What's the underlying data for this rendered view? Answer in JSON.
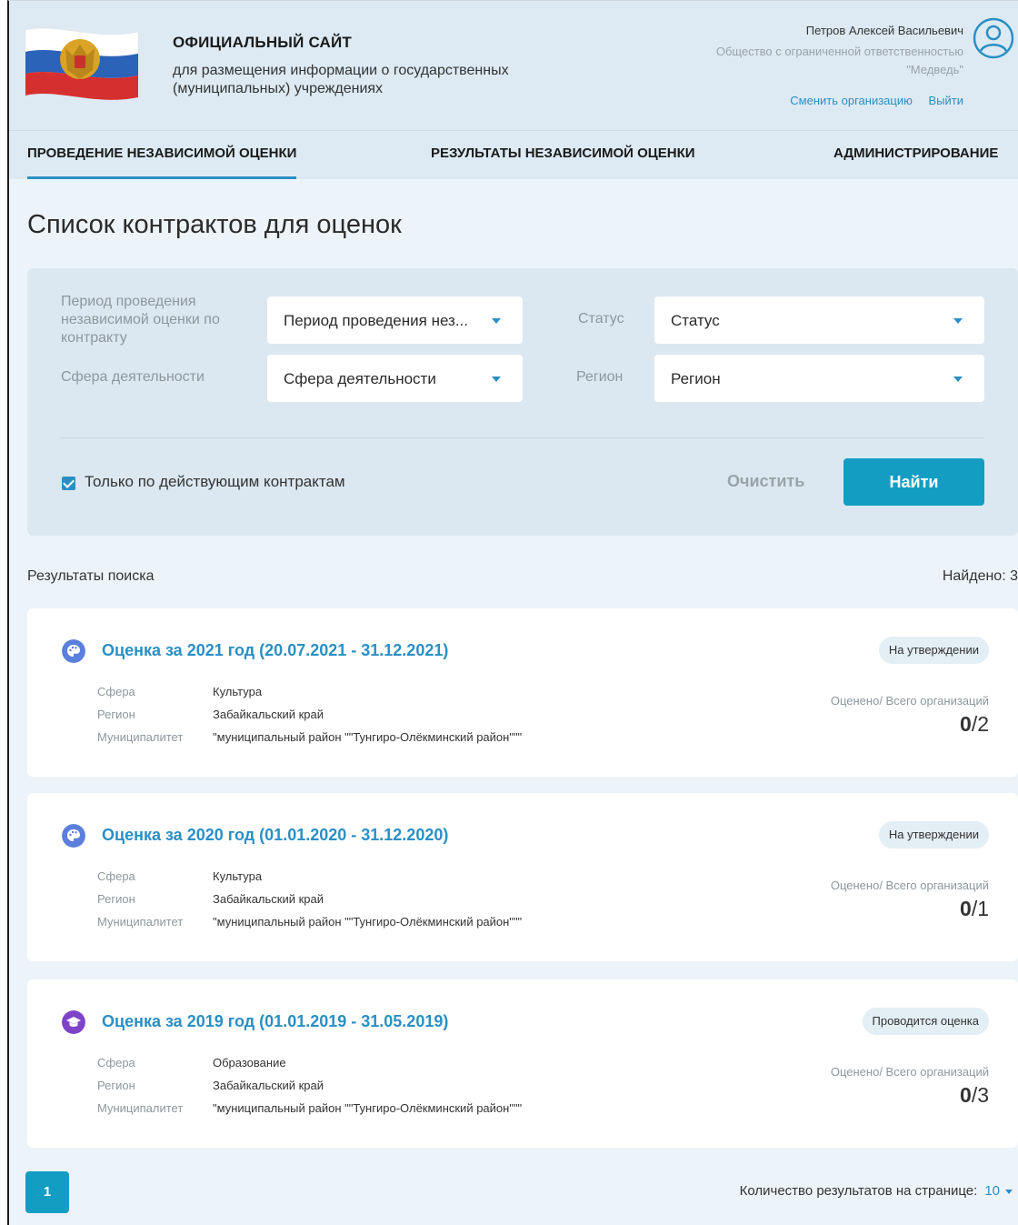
{
  "header": {
    "title": "ОФИЦИАЛЬНЫЙ САЙТ",
    "subtitle": "для размещения информации о государственных (муниципальных) учреждениях",
    "user_name": "Петров Алексей Васильевич",
    "user_org": "Общество с ограниченной ответственностью \"Медведь\"",
    "change_org": "Сменить организацию",
    "logout": "Выйти"
  },
  "nav": {
    "items": [
      {
        "label": "ПРОВЕДЕНИЕ НЕЗАВИСИМОЙ ОЦЕНКИ",
        "active": true
      },
      {
        "label": "РЕЗУЛЬТАТЫ НЕЗАВИСИМОЙ ОЦЕНКИ",
        "active": false
      },
      {
        "label": "АДМИНИСТРИРОВАНИЕ",
        "active": false
      }
    ]
  },
  "page_title": "Список контрактов для оценок",
  "filters": {
    "period_label": "Период проведения независимой оценки по контракту",
    "period_value": "Период проведения нез...",
    "status_label": "Статус",
    "status_value": "Статус",
    "sphere_label": "Сфера деятельности",
    "sphere_value": "Сфера деятельности",
    "region_label": "Регион",
    "region_value": "Регион",
    "only_active_label": "Только по действующим контрактам",
    "only_active_checked": true,
    "clear_label": "Очистить",
    "find_label": "Найти"
  },
  "results": {
    "label": "Результаты поиска",
    "found": "Найдено: 3",
    "meta_keys": {
      "sphere": "Сфера",
      "region": "Регион",
      "municipality": "Муниципалитет"
    },
    "count_label": "Оценено/ Всего организаций",
    "items": [
      {
        "title": "Оценка за 2021 год (20.07.2021 - 31.12.2021)",
        "icon": "palette-icon",
        "icon_color": "#5b7fde",
        "sphere": "Культура",
        "region": "Забайкальский край",
        "municipality": "\"муниципальный район \"\"Тунгиро-Олёкминский район\"\"\"",
        "status": "На утверждении",
        "evaluated": "0",
        "total": "/2"
      },
      {
        "title": "Оценка за 2020 год (01.01.2020 - 31.12.2020)",
        "icon": "palette-icon",
        "icon_color": "#5b7fde",
        "sphere": "Культура",
        "region": "Забайкальский край",
        "municipality": "\"муниципальный район \"\"Тунгиро-Олёкминский район\"\"\"",
        "status": "На утверждении",
        "evaluated": "0",
        "total": "/1"
      },
      {
        "title": "Оценка за 2019 год (01.01.2019 - 31.05.2019)",
        "icon": "graduation-cap-icon",
        "icon_color": "#7d44c8",
        "sphere": "Образование",
        "region": "Забайкальский край",
        "municipality": "\"муниципальный район \"\"Тунгиро-Олёкминский район\"\"\"",
        "status": "Проводится оценка",
        "evaluated": "0",
        "total": "/3"
      }
    ]
  },
  "pagination": {
    "current_page": "1",
    "per_page_label": "Количество результатов на странице:",
    "per_page_value": "10"
  },
  "colors": {
    "accent": "#2b8fc4",
    "button": "#139dc3",
    "panel": "#dbe8f1"
  }
}
